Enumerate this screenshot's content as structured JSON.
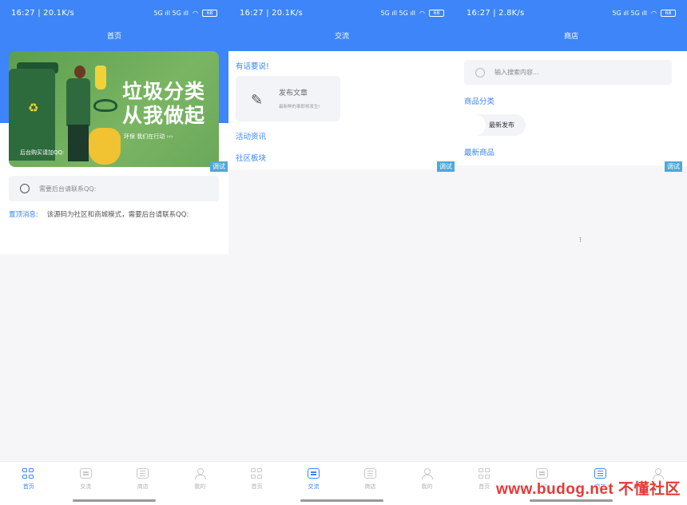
{
  "screens": [
    {
      "status": {
        "time": "16:27 | 20.1K/s",
        "signal": "5G ıll 5G ıll",
        "battery": "68"
      },
      "title": "首页",
      "banner": {
        "line1": "垃圾分类",
        "line2": "从我做起",
        "tag": "环保  我们在行动  ›››",
        "qq": "后台购买请加QQ:"
      },
      "debug_badge": "调试",
      "search_placeholder": "需要后台请联系QQ:",
      "notice": {
        "label": "置顶消息:",
        "text": "该源码为社区和商城模式，需要后台请联系QQ:"
      }
    },
    {
      "status": {
        "time": "16:27 | 20.1K/s",
        "signal": "5G ıll 5G ıll",
        "battery": "68"
      },
      "title": "交流",
      "section_post": "有话要说!",
      "post_card": {
        "title": "发布文章",
        "subtitle": "最新鲜的事即将发生!"
      },
      "section_news": "活动资讯",
      "section_board": "社区板块",
      "debug_badge": "调试"
    },
    {
      "status": {
        "time": "16:27 | 2.8K/s",
        "signal": "5G ıll 5G ıll",
        "battery": "68"
      },
      "title": "商店",
      "search_placeholder": "输入搜索内容...",
      "section_category": "商品分类",
      "chip_label": "最新发布",
      "section_latest": "最新商品",
      "debug_badge": "调试",
      "loading": "⁝"
    }
  ],
  "tabs": [
    "首页",
    "交流",
    "商店",
    "我的"
  ],
  "active_tabs": [
    0,
    1,
    2
  ],
  "watermark": "www.budog.net 不懂社区",
  "colors": {
    "primary": "#3d85f8",
    "badge": "#4fa8d8",
    "watermark": "#e53935"
  }
}
